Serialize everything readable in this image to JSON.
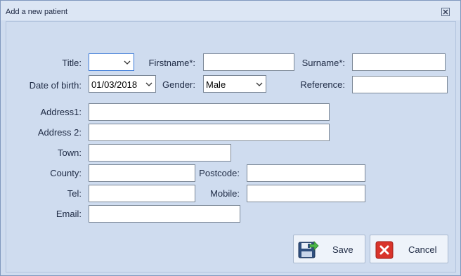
{
  "window": {
    "title": "Add a new patient"
  },
  "form": {
    "title_label": "Title:",
    "title_value": "",
    "firstname_label": "Firstname*:",
    "firstname_value": "",
    "surname_label": "Surname*:",
    "surname_value": "",
    "dob_label": "Date of birth:",
    "dob_value": "01/03/2018",
    "gender_label": "Gender:",
    "gender_value": "Male",
    "reference_label": "Reference:",
    "reference_value": "",
    "address1_label": "Address1:",
    "address1_value": "",
    "address2_label": "Address 2:",
    "address2_value": "",
    "town_label": "Town:",
    "town_value": "",
    "county_label": "County:",
    "county_value": "",
    "postcode_label": "Postcode:",
    "postcode_value": "",
    "tel_label": "Tel:",
    "tel_value": "",
    "mobile_label": "Mobile:",
    "mobile_value": "",
    "email_label": "Email:",
    "email_value": ""
  },
  "buttons": {
    "save_label": "Save",
    "cancel_label": "Cancel",
    "save_icon": "floppy-disk-arrow-icon",
    "cancel_icon": "red-x-icon"
  },
  "colors": {
    "background": "#cfdcef",
    "titlebar": "#dce6f4",
    "focus_border": "#3b7ad8",
    "cancel_red": "#d9342b"
  }
}
